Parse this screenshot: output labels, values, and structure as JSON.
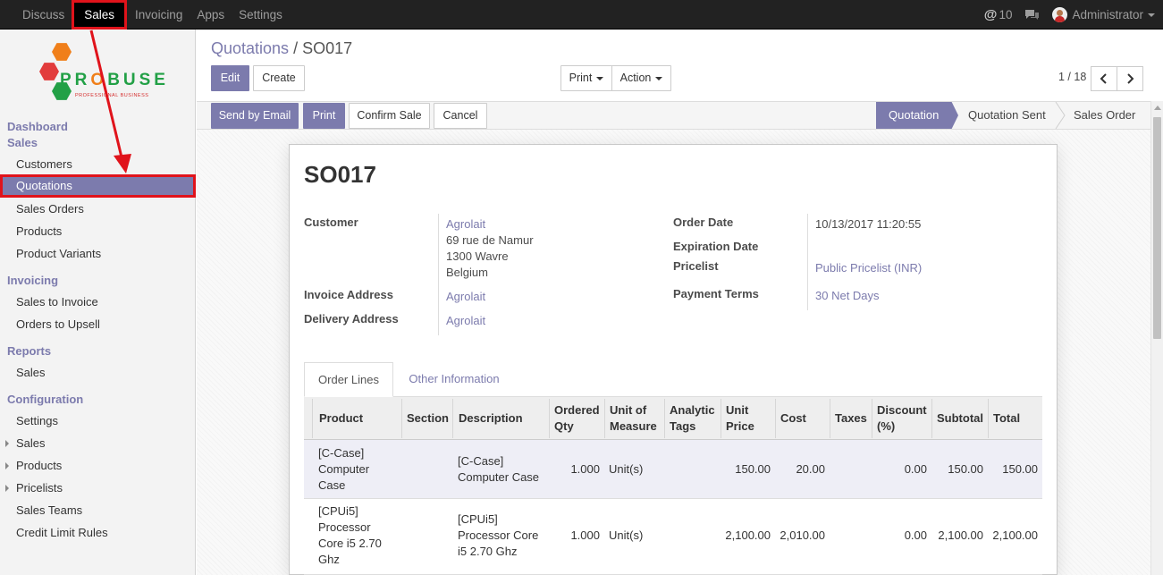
{
  "topbar": {
    "menu": [
      "Discuss",
      "Sales",
      "Invoicing",
      "Apps",
      "Settings"
    ],
    "active_menu": "Sales",
    "messages_count": "10",
    "user": "Administrator"
  },
  "logo": {
    "brand_pre": "PR",
    "brand_o": "O",
    "brand_post": "BUSE",
    "tagline": "PROFESSIONAL BUSINESS"
  },
  "sidebar": {
    "dashboard": "Dashboard",
    "sales_section": "Sales",
    "sales_items": [
      "Customers",
      "Quotations",
      "Sales Orders",
      "Products",
      "Product Variants"
    ],
    "invoicing_section": "Invoicing",
    "invoicing_items": [
      "Sales to Invoice",
      "Orders to Upsell"
    ],
    "reports_section": "Reports",
    "reports_items": [
      "Sales"
    ],
    "config_section": "Configuration",
    "config_items": [
      "Settings",
      "Sales",
      "Products",
      "Pricelists",
      "Sales Teams",
      "Credit Limit Rules"
    ]
  },
  "breadcrumb": {
    "parent": "Quotations",
    "separator": "/",
    "current": "SO017"
  },
  "buttons": {
    "edit": "Edit",
    "create": "Create",
    "print": "Print",
    "action": "Action",
    "send_email": "Send by Email",
    "print2": "Print",
    "confirm": "Confirm Sale",
    "cancel": "Cancel"
  },
  "pager": {
    "text": "1 / 18",
    "prev": "‹",
    "next": "›"
  },
  "status": {
    "stages": [
      "Quotation",
      "Quotation Sent",
      "Sales Order"
    ],
    "active": "Quotation"
  },
  "order": {
    "name": "SO017",
    "labels": {
      "customer": "Customer",
      "invoice_address": "Invoice Address",
      "delivery_address": "Delivery Address",
      "order_date": "Order Date",
      "expiration_date": "Expiration Date",
      "pricelist": "Pricelist",
      "payment_terms": "Payment Terms"
    },
    "customer_name": "Agrolait",
    "customer_address": [
      "69 rue de Namur",
      "1300 Wavre",
      "Belgium"
    ],
    "invoice_address": "Agrolait",
    "delivery_address": "Agrolait",
    "order_date": "10/13/2017 11:20:55",
    "pricelist": "Public Pricelist (INR)",
    "payment_terms": "30 Net Days"
  },
  "tabs": [
    "Order Lines",
    "Other Information"
  ],
  "table": {
    "headers": {
      "product": "Product",
      "section": "Section",
      "description": "Description",
      "ordered_qty": [
        "Ordered",
        "Qty"
      ],
      "uom": [
        "Unit of",
        "Measure"
      ],
      "analytic": [
        "Analytic",
        "Tags"
      ],
      "unit_price": [
        "Unit",
        "Price"
      ],
      "cost": "Cost",
      "taxes": "Taxes",
      "discount": [
        "Discount",
        "(%)"
      ],
      "subtotal": "Subtotal",
      "total": "Total"
    },
    "rows": [
      {
        "product": [
          "[C-Case]",
          "Computer",
          "Case"
        ],
        "description": [
          "[C-Case]",
          "Computer Case"
        ],
        "qty": "1.000",
        "uom": "Unit(s)",
        "price": "150.00",
        "cost": "20.00",
        "discount": "0.00",
        "subtotal": "150.00",
        "total": "150.00"
      },
      {
        "product": [
          "[CPUi5]",
          "Processor",
          "Core i5 2.70",
          "Ghz"
        ],
        "description": [
          "[CPUi5]",
          "Processor Core",
          "i5 2.70 Ghz"
        ],
        "qty": "1.000",
        "uom": "Unit(s)",
        "price": "2,100.00",
        "cost": "2,010.00",
        "discount": "0.00",
        "subtotal": "2,100.00",
        "total": "2,100.00"
      }
    ]
  },
  "colors": {
    "primary": "#7c7bad",
    "highlight": "#e0131b",
    "navbar": "#222222"
  },
  "icons": {
    "messages": "at-icon",
    "chat": "chat-bubble-icon",
    "avatar": "user-avatar",
    "pager_prev": "chevron-left-icon",
    "pager_next": "chevron-right-icon"
  }
}
